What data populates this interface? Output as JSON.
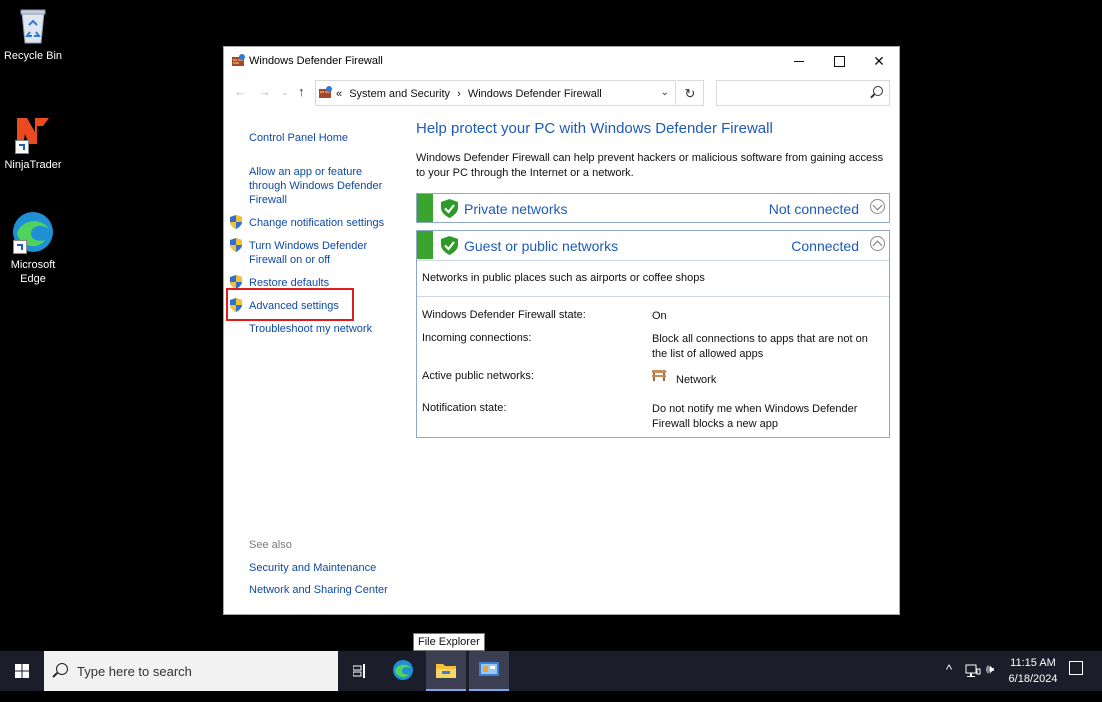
{
  "desktop": {
    "icons": [
      {
        "label": "Recycle Bin"
      },
      {
        "label": "NinjaTrader"
      },
      {
        "label": "Microsoft Edge"
      }
    ]
  },
  "window": {
    "title": "Windows Defender Firewall",
    "breadcrumb": [
      "«",
      "System and Security",
      "›",
      "Windows Defender Firewall"
    ],
    "search_placeholder": ""
  },
  "leftnav": {
    "home": "Control Panel Home",
    "allow_app": [
      "Allow an app or feature",
      "through Windows Defender",
      "Firewall"
    ],
    "change_notification": "Change notification settings",
    "turn_on_off": [
      "Turn Windows Defender",
      "Firewall on or off"
    ],
    "restore_defaults": "Restore defaults",
    "advanced_settings": "Advanced settings",
    "troubleshoot": "Troubleshoot my network",
    "see_also_label": "See also",
    "security_maintenance": "Security and Maintenance",
    "network_sharing": "Network and Sharing Center"
  },
  "content": {
    "heading": "Help protect your PC with Windows Defender Firewall",
    "description": "Windows Defender Firewall can help prevent hackers or malicious software from gaining access to your PC through the Internet or a network.",
    "private": {
      "name": "Private networks",
      "state": "Not connected"
    },
    "public": {
      "name": "Guest or public networks",
      "state": "Connected",
      "subtitle": "Networks in public places such as airports or coffee shops",
      "rows": [
        {
          "label": "Windows Defender Firewall state:",
          "value": "On"
        },
        {
          "label": "Incoming connections:",
          "value": "Block all connections to apps that are not on the list of allowed apps"
        },
        {
          "label": "Active public networks:",
          "value": "Network"
        },
        {
          "label": "Notification state:",
          "value": "Do not notify me when Windows Defender Firewall blocks a new app"
        }
      ]
    }
  },
  "tooltip": "File Explorer",
  "taskbar": {
    "search_placeholder": "Type here to search",
    "time": "11:15 AM",
    "date": "6/18/2024"
  },
  "colors": {
    "accent": "#1e5bb8",
    "link": "#0f4aa5",
    "green": "#3aa42f",
    "highlight": "#e41b1b"
  }
}
